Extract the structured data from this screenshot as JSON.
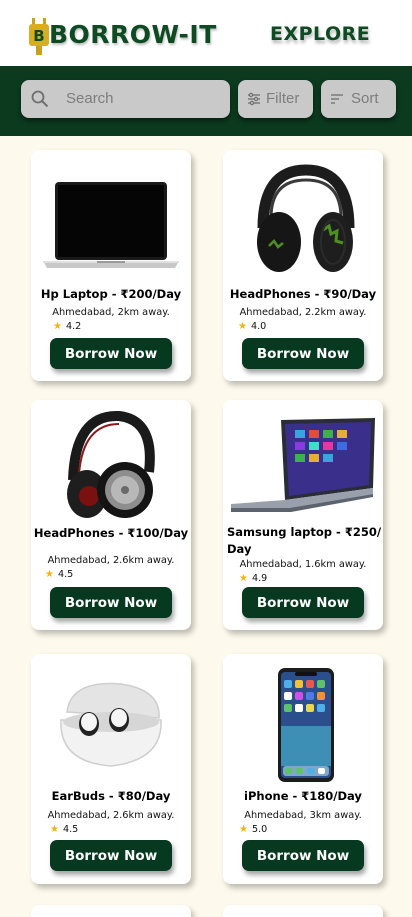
{
  "header": {
    "brand": "BORROW-IT",
    "explore_label": "EXPLORE"
  },
  "toolbar": {
    "search_placeholder": "Search",
    "filter_label": "Filter",
    "sort_label": "Sort"
  },
  "products": [
    {
      "name": "Hp Laptop - ₹200/Day",
      "location": "Ahmedabad, 2km away.",
      "rating": "4.2",
      "button": "Borrow Now",
      "icon": "laptop-image"
    },
    {
      "name": "HeadPhones - ₹90/Day",
      "location": "Ahmedabad, 2.2km away.",
      "rating": "4.0",
      "button": "Borrow Now",
      "icon": "headphones-image"
    },
    {
      "name": "HeadPhones - ₹100/Day",
      "location": "Ahmedabad, 2.6km away.",
      "rating": "4.5",
      "button": "Borrow Now",
      "icon": "headphones-image"
    },
    {
      "name": "Samsung laptop - ₹250/ Day",
      "location": "Ahmedabad, 1.6km away.",
      "rating": "4.9",
      "button": "Borrow Now",
      "icon": "laptop-image"
    },
    {
      "name": "EarBuds - ₹80/Day",
      "location": "Ahmedabad, 2.6km away.",
      "rating": "4.5",
      "button": "Borrow Now",
      "icon": "earbuds-image"
    },
    {
      "name": "iPhone - ₹180/Day",
      "location": "Ahmedabad, 3km away.",
      "rating": "5.0",
      "button": "Borrow Now",
      "icon": "phone-image"
    }
  ],
  "colors": {
    "brand_green": "#0e4a22",
    "toolbar_bg": "#0b3a1f",
    "button_bg": "#063920",
    "page_bg": "#fdf9ec",
    "star": "#f2b416"
  }
}
